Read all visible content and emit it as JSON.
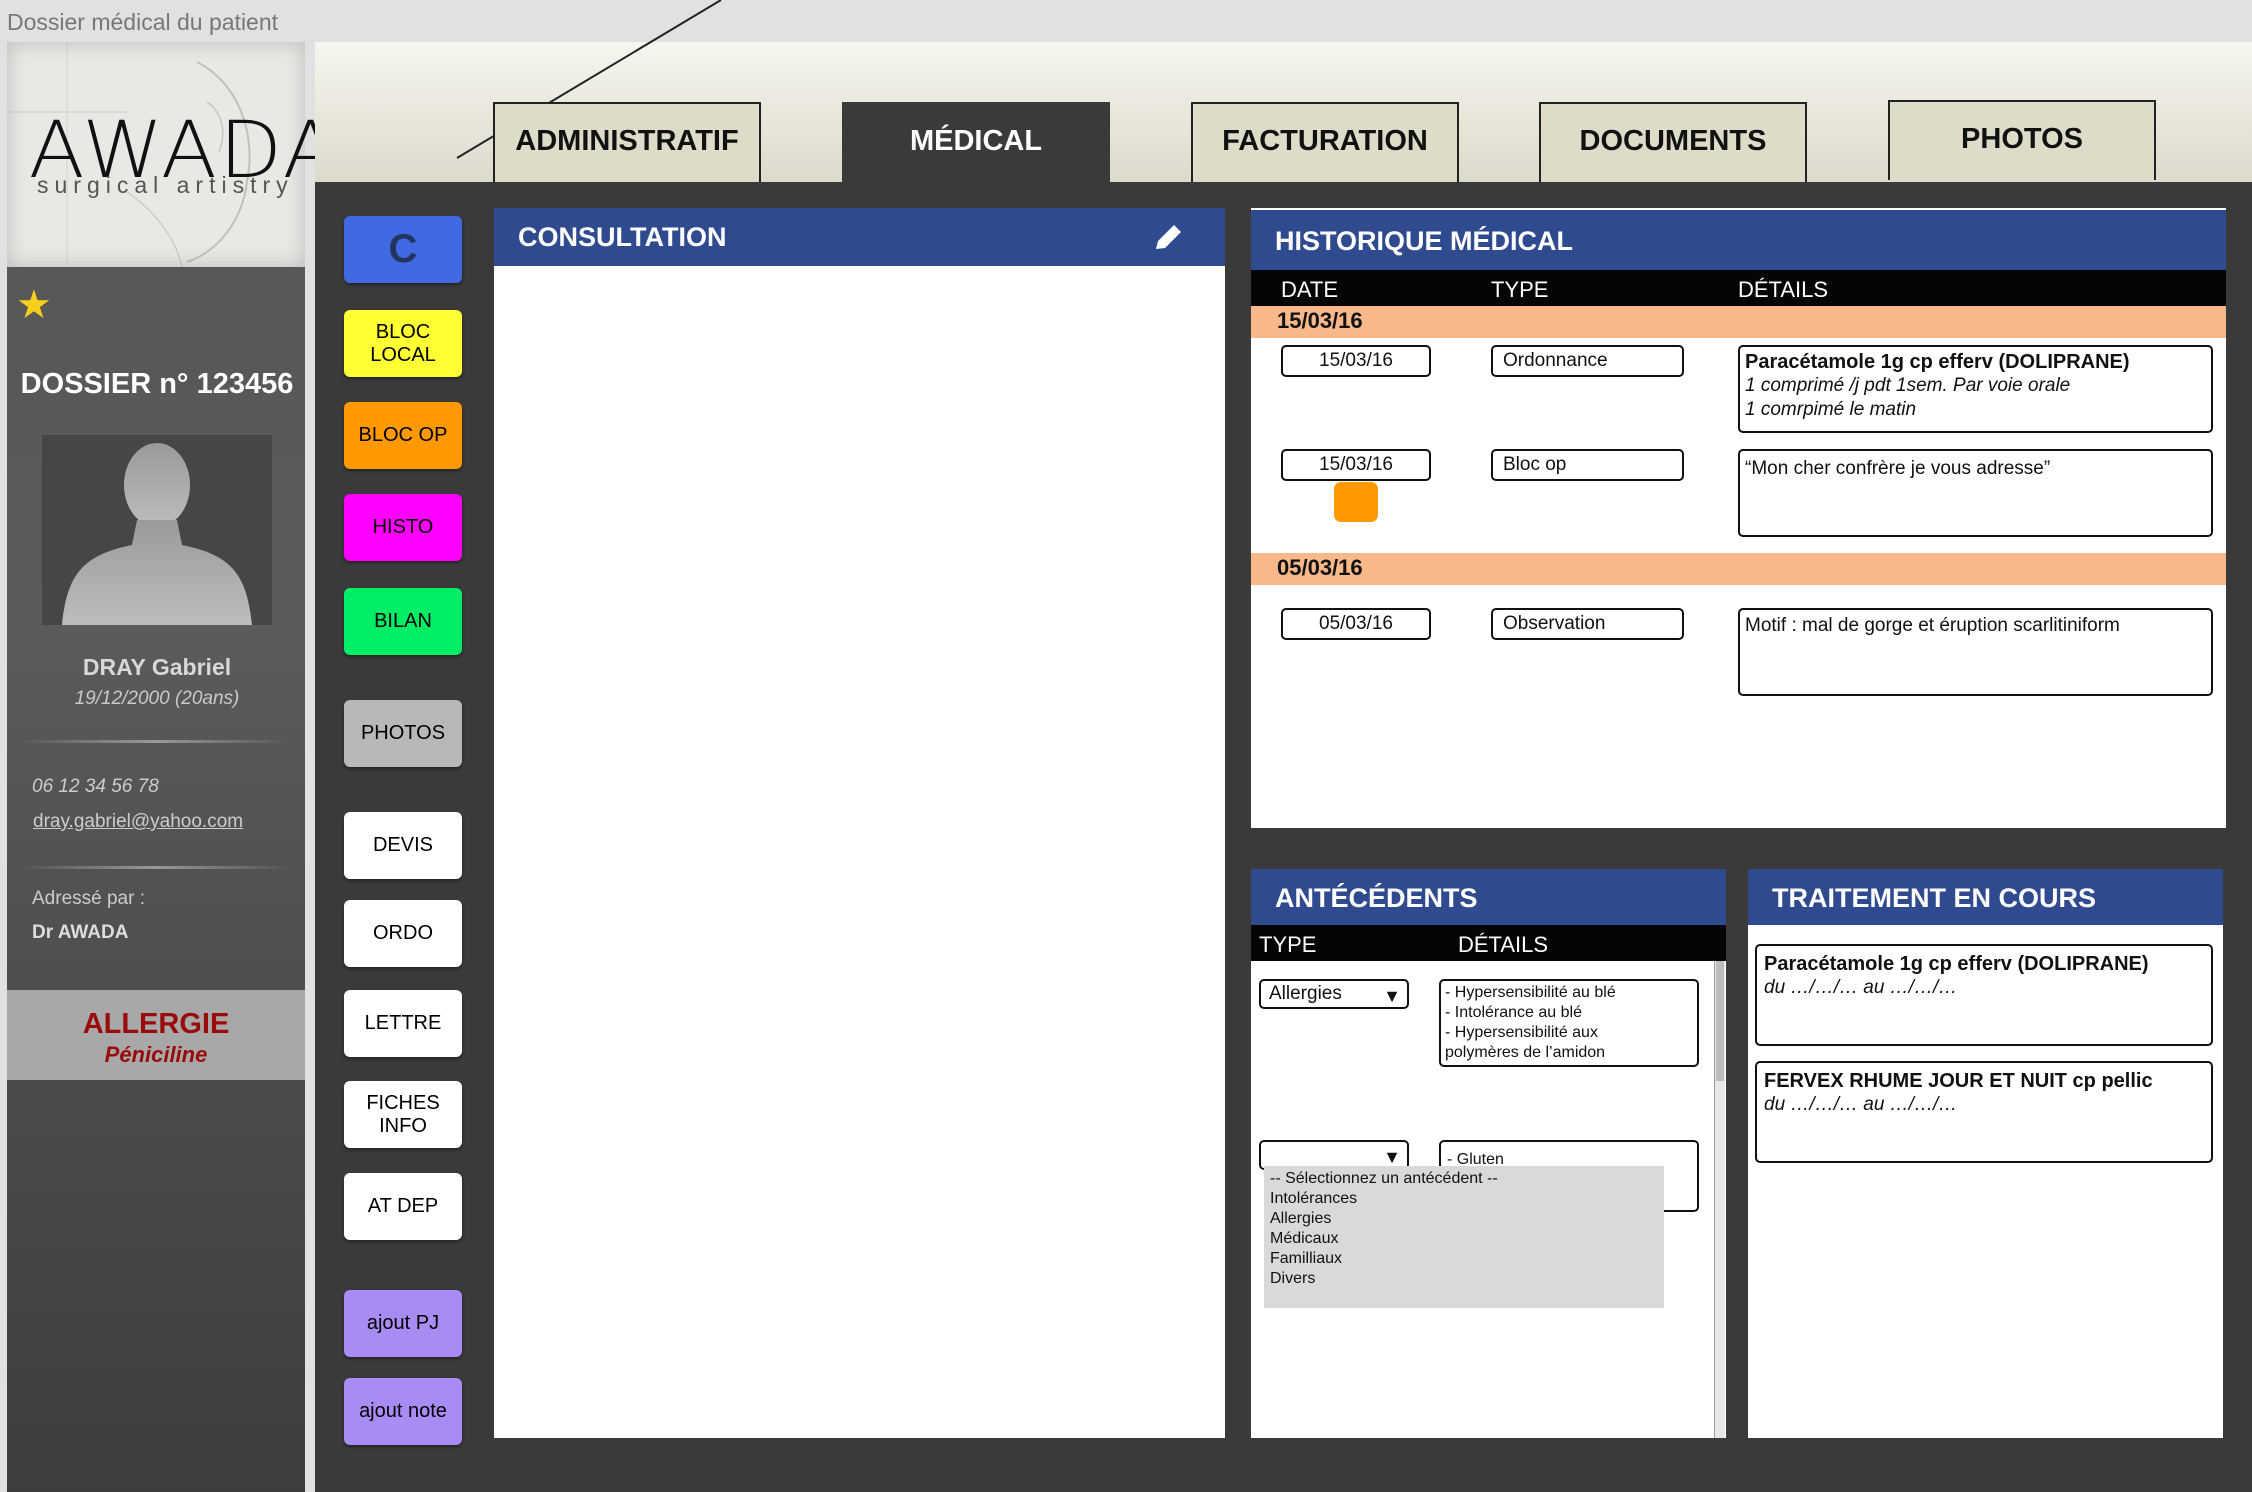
{
  "window": {
    "title": "Dossier médical du patient"
  },
  "brand": {
    "logo_text": "AWADA",
    "tagline": "surgical artistry"
  },
  "patient": {
    "dossier": "DOSSIER n° 123456",
    "name": "DRAY Gabriel",
    "dob": "19/12/2000 (20ans)",
    "phone": "06 12 34 56 78",
    "email": "dray.gabriel@yahoo.com",
    "referred_label": "Adressé par :",
    "referred_by": "Dr AWADA",
    "allergy_title": "ALLERGIE",
    "allergy_value": "Péniciline"
  },
  "tabs": [
    "ADMINISTRATIF",
    "MÉDICAL",
    "FACTURATION",
    "DOCUMENTS",
    "PHOTOS"
  ],
  "active_tab": "MÉDICAL",
  "side_buttons": [
    {
      "label": "C",
      "color": "#4169e1"
    },
    {
      "label": "BLOC\nLOCAL",
      "color": "#ffff33"
    },
    {
      "label": "BLOC OP",
      "color": "#ff9900"
    },
    {
      "label": "HISTO",
      "color": "#ff00ff"
    },
    {
      "label": "BILAN",
      "color": "#00ee66"
    },
    {
      "label": "PHOTOS",
      "color": "#b8b8b8"
    },
    {
      "label": "DEVIS",
      "color": "#ffffff"
    },
    {
      "label": "ORDO",
      "color": "#ffffff"
    },
    {
      "label": "LETTRE",
      "color": "#ffffff"
    },
    {
      "label": "FICHES\nINFO",
      "color": "#ffffff"
    },
    {
      "label": "AT DEP",
      "color": "#ffffff"
    },
    {
      "label": "ajout PJ",
      "color": "#a98bf4"
    },
    {
      "label": "ajout note",
      "color": "#a98bf4"
    }
  ],
  "consultation": {
    "title": "CONSULTATION",
    "edit_icon": "pencil-icon"
  },
  "history": {
    "title": "HISTORIQUE MÉDICAL",
    "columns": [
      "DATE",
      "TYPE",
      "DÉTAILS"
    ],
    "groups": [
      {
        "date": "15/03/16",
        "entries": [
          {
            "date": "15/03/16",
            "type": "Ordonnance",
            "detail_title": "Paracétamole 1g cp efferv (DOLIPRANE)",
            "detail_lines": [
              "1 comprimé /j pdt 1sem. Par voie orale",
              "1 comrpimé le matin"
            ]
          },
          {
            "date": "15/03/16",
            "type": "Bloc op",
            "detail_text": "“Mon cher confrère je vous adresse”",
            "marker_color": "#ff9900"
          }
        ]
      },
      {
        "date": "05/03/16",
        "entries": [
          {
            "date": "05/03/16",
            "type": "Observation",
            "detail_text": "Motif : mal de gorge et éruption scarlitiniform"
          }
        ]
      }
    ]
  },
  "antecedents": {
    "title": "ANTÉCÉDENTS",
    "columns": [
      "TYPE",
      "DÉTAILS"
    ],
    "rows": [
      {
        "type": "Allergies",
        "details": [
          "- Hypersensibilité au blé",
          "- Intolérance au blé",
          "- Hypersensibilité aux",
          "polymères de l’amidon"
        ]
      },
      {
        "type": "",
        "details": [
          "- Gluten"
        ]
      }
    ],
    "dropdown_options": [
      "-- Sélectionnez un antécédent --",
      "Intolérances",
      "Allergies",
      "Médicaux",
      "Familliaux",
      "Divers"
    ]
  },
  "treatment": {
    "title": "TRAITEMENT EN COURS",
    "items": [
      {
        "name": "Paracétamole 1g cp efferv (DOLIPRANE)",
        "period": "du …/…/… au …/…/…"
      },
      {
        "name": "FERVEX RHUME JOUR ET NUIT cp pellic",
        "period": "du …/…/… au …/…/…"
      }
    ]
  }
}
